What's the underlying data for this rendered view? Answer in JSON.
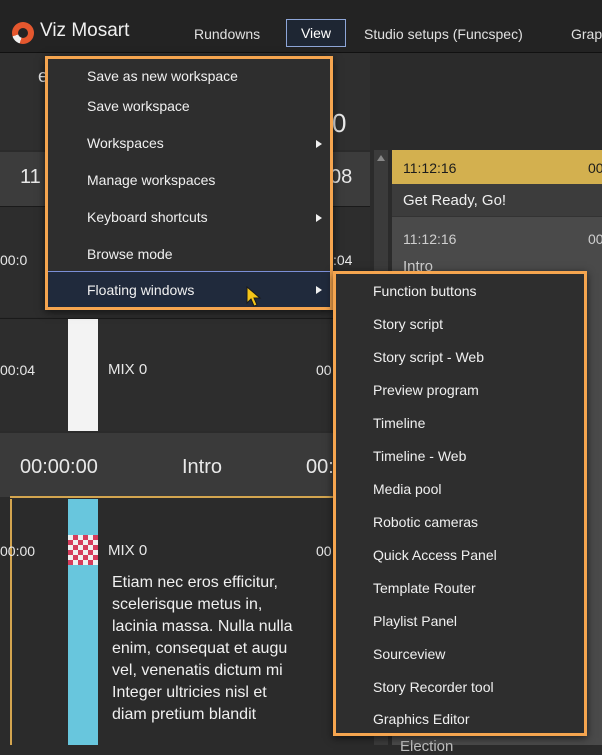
{
  "menubar": {
    "app_title": "Viz Mosart",
    "items": [
      "Rundowns",
      "View",
      "Studio setups (Funcspec)",
      "Grap"
    ]
  },
  "background": {
    "partial_char": "e",
    "top_number": "0",
    "row1_time": "11",
    "row1_right": "08",
    "row2_time": "00:0",
    "row2_right": ":04",
    "row3_time": "00:04",
    "row3_mix": "MIX 0",
    "row3_right": "00",
    "intro_time": "00:00:00",
    "intro_label": "Intro",
    "intro_right": "00:",
    "row4_time": "00:00",
    "row4_mix": "MIX 0",
    "row4_right": "00",
    "story_lines": [
      "Etiam nec eros efficitur,",
      "scelerisque metus in,",
      "lacinia massa. Nulla nulla",
      "enim, consequat et augu",
      "vel, venenatis dictum mi",
      "Integer ultricies nisl et",
      "diam pretium blandit"
    ]
  },
  "right_panel": {
    "active_time": "11:12:16",
    "active_edge": "00",
    "active_title": "Get Ready, Go!",
    "next_time": "11:12:16",
    "next_edge": "00",
    "next_title": "Intro",
    "bottom_partial": "Election"
  },
  "view_menu": {
    "items": [
      {
        "label": "Save as new workspace",
        "submenu": false
      },
      {
        "label": "Save workspace",
        "submenu": false
      },
      {
        "label": "Workspaces",
        "submenu": true
      },
      {
        "label": "Manage workspaces",
        "submenu": false
      },
      {
        "label": "Keyboard shortcuts",
        "submenu": true
      },
      {
        "label": "Browse mode",
        "submenu": false
      },
      {
        "label": "Floating windows",
        "submenu": true,
        "highlighted": true
      }
    ]
  },
  "floating_windows_menu": {
    "items": [
      "Function buttons",
      "Story script",
      "Story script - Web",
      "Preview program",
      "Timeline",
      "Timeline - Web",
      "Media pool",
      "Robotic cameras",
      "Quick Access Panel",
      "Template Router",
      "Playlist Panel",
      "Sourceview",
      "Story Recorder tool",
      "Graphics Editor"
    ]
  },
  "colors": {
    "highlight_border": "#f5a54f",
    "active_item": "#d3b04f",
    "view_button_border": "#8ea6d8"
  }
}
